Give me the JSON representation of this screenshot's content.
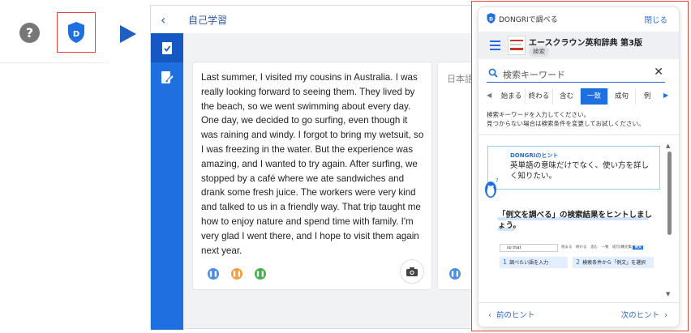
{
  "app": {
    "title": "自己学習",
    "back_icon": "chevron-left-icon",
    "rail_icons": [
      "checklist-icon",
      "edit-document-icon"
    ]
  },
  "english_text": "Last summer, I visited my cousins in Australia. I was really looking forward to seeing them. They lived by the beach, so we went swimming about every day. One day, we decided to go surfing, even though it was raining and windy. I forgot to bring my wetsuit, so I was freezing in the water. But the experience was amazing, and I wanted to try again. After surfing, we stopped by a café where we ate sandwiches and drank some fresh juice. The workers were very kind and talked to us in a friendly way. That trip taught me how to enjoy nature and spend time with family. I'm very glad I went there, and I hope to visit them again next year.",
  "japanese_card_label": "日本語",
  "panel": {
    "title": "DONGRIで調べる",
    "close": "閉じる",
    "dictionary": {
      "name": "エースクラウン英和辞典 第3版",
      "tag": "検索"
    },
    "search_placeholder": "検索キーワード",
    "modes": [
      "始まる",
      "終わる",
      "含む",
      "一致",
      "成句",
      "例"
    ],
    "active_mode": "一致",
    "message_line1": "検索キーワードを入力してください。",
    "message_line2": "見つからない場合は検索条件を変更してお試しください。",
    "hint_label": "DONGRIのヒント",
    "hint_text": "英単語の意味だけでなく、使い方を詳しく知りたい。",
    "hint_heading": "「例文を調べる」の検索結果をヒントしましょう。",
    "mini": {
      "search_value": "so that",
      "tabs": "始まる　終わる　含む　一致　成句/構文集",
      "tab_active": "例文",
      "step1": "調べたい語を入力",
      "step2": "検索条件から「例文」を選択",
      "step1_num": "1",
      "step2_num": "2"
    },
    "prev_hint": "前のヒント",
    "next_hint": "次のヒント"
  },
  "colors": {
    "accent": "#1e6fe0",
    "highlight_border": "#e0473a"
  }
}
